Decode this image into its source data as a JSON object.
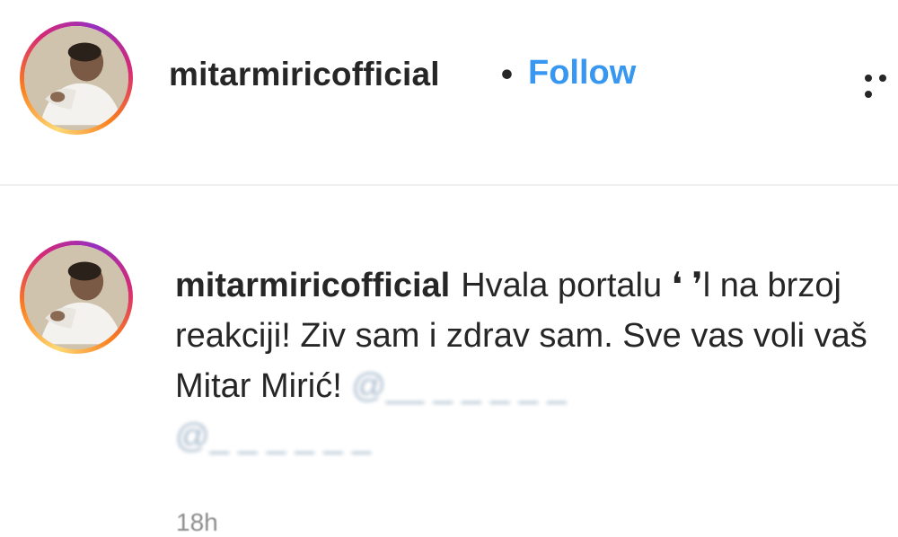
{
  "post_header": {
    "username": "mitarmiricofficial",
    "separator": "•",
    "follow_label": "Follow"
  },
  "comment": {
    "username": "mitarmiricofficial",
    "text": "Hvala portalu ❛ ❜l na brzoj reakciji! Ziv sam i zdrav sam. Sve vas voli vaš Mitar Mirić!",
    "mention_1": "@__ _ _ _ _ _",
    "mention_2": "@_ _ _ _ _ _",
    "timestamp": "18h"
  },
  "colors": {
    "follow": "#3897f0",
    "text": "#262626",
    "muted": "#8e8e8e"
  },
  "icons": {
    "more": "more-options-icon"
  }
}
